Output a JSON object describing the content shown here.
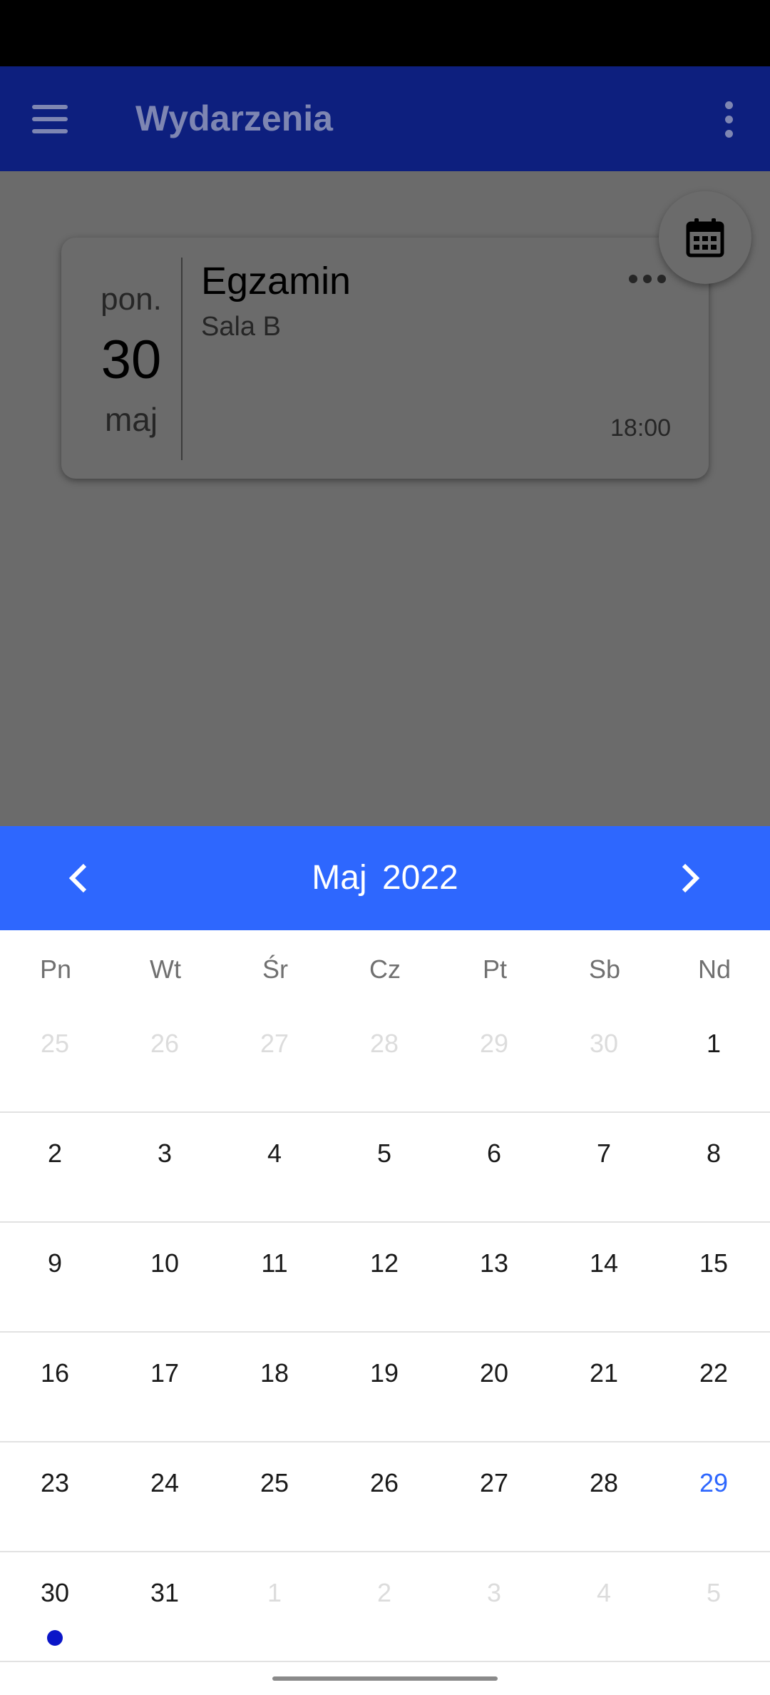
{
  "app_bar": {
    "title": "Wydarzenia",
    "menu_icon": "hamburger-menu-icon",
    "more_icon": "more-vertical-icon",
    "background": "#0d1f7e"
  },
  "fab": {
    "icon": "calendar-icon"
  },
  "event": {
    "day_name": "pon.",
    "day_number": "30",
    "month": "maj",
    "title": "Egzamin",
    "place": "Sala B",
    "time": "18:00",
    "more_icon": "more-horizontal-icon"
  },
  "calendar": {
    "month_label": "Maj  2022",
    "accent": "#2e67fe",
    "prev_icon": "chevron-left-icon",
    "next_icon": "chevron-right-icon",
    "weekdays": [
      "Pn",
      "Wt",
      "Śr",
      "Cz",
      "Pt",
      "Sb",
      "Nd"
    ],
    "weeks": [
      [
        {
          "d": "25",
          "m": true
        },
        {
          "d": "26",
          "m": true
        },
        {
          "d": "27",
          "m": true
        },
        {
          "d": "28",
          "m": true
        },
        {
          "d": "29",
          "m": true
        },
        {
          "d": "30",
          "m": true
        },
        {
          "d": "1"
        }
      ],
      [
        {
          "d": "2"
        },
        {
          "d": "3"
        },
        {
          "d": "4"
        },
        {
          "d": "5"
        },
        {
          "d": "6"
        },
        {
          "d": "7"
        },
        {
          "d": "8"
        }
      ],
      [
        {
          "d": "9"
        },
        {
          "d": "10"
        },
        {
          "d": "11"
        },
        {
          "d": "12"
        },
        {
          "d": "13"
        },
        {
          "d": "14"
        },
        {
          "d": "15"
        }
      ],
      [
        {
          "d": "16"
        },
        {
          "d": "17"
        },
        {
          "d": "18"
        },
        {
          "d": "19"
        },
        {
          "d": "20"
        },
        {
          "d": "21"
        },
        {
          "d": "22"
        }
      ],
      [
        {
          "d": "23"
        },
        {
          "d": "24"
        },
        {
          "d": "25"
        },
        {
          "d": "26"
        },
        {
          "d": "27"
        },
        {
          "d": "28"
        },
        {
          "d": "29",
          "today": true
        }
      ],
      [
        {
          "d": "30",
          "event": true
        },
        {
          "d": "31"
        },
        {
          "d": "1",
          "m": true
        },
        {
          "d": "2",
          "m": true
        },
        {
          "d": "3",
          "m": true
        },
        {
          "d": "4",
          "m": true
        },
        {
          "d": "5",
          "m": true
        }
      ]
    ]
  }
}
